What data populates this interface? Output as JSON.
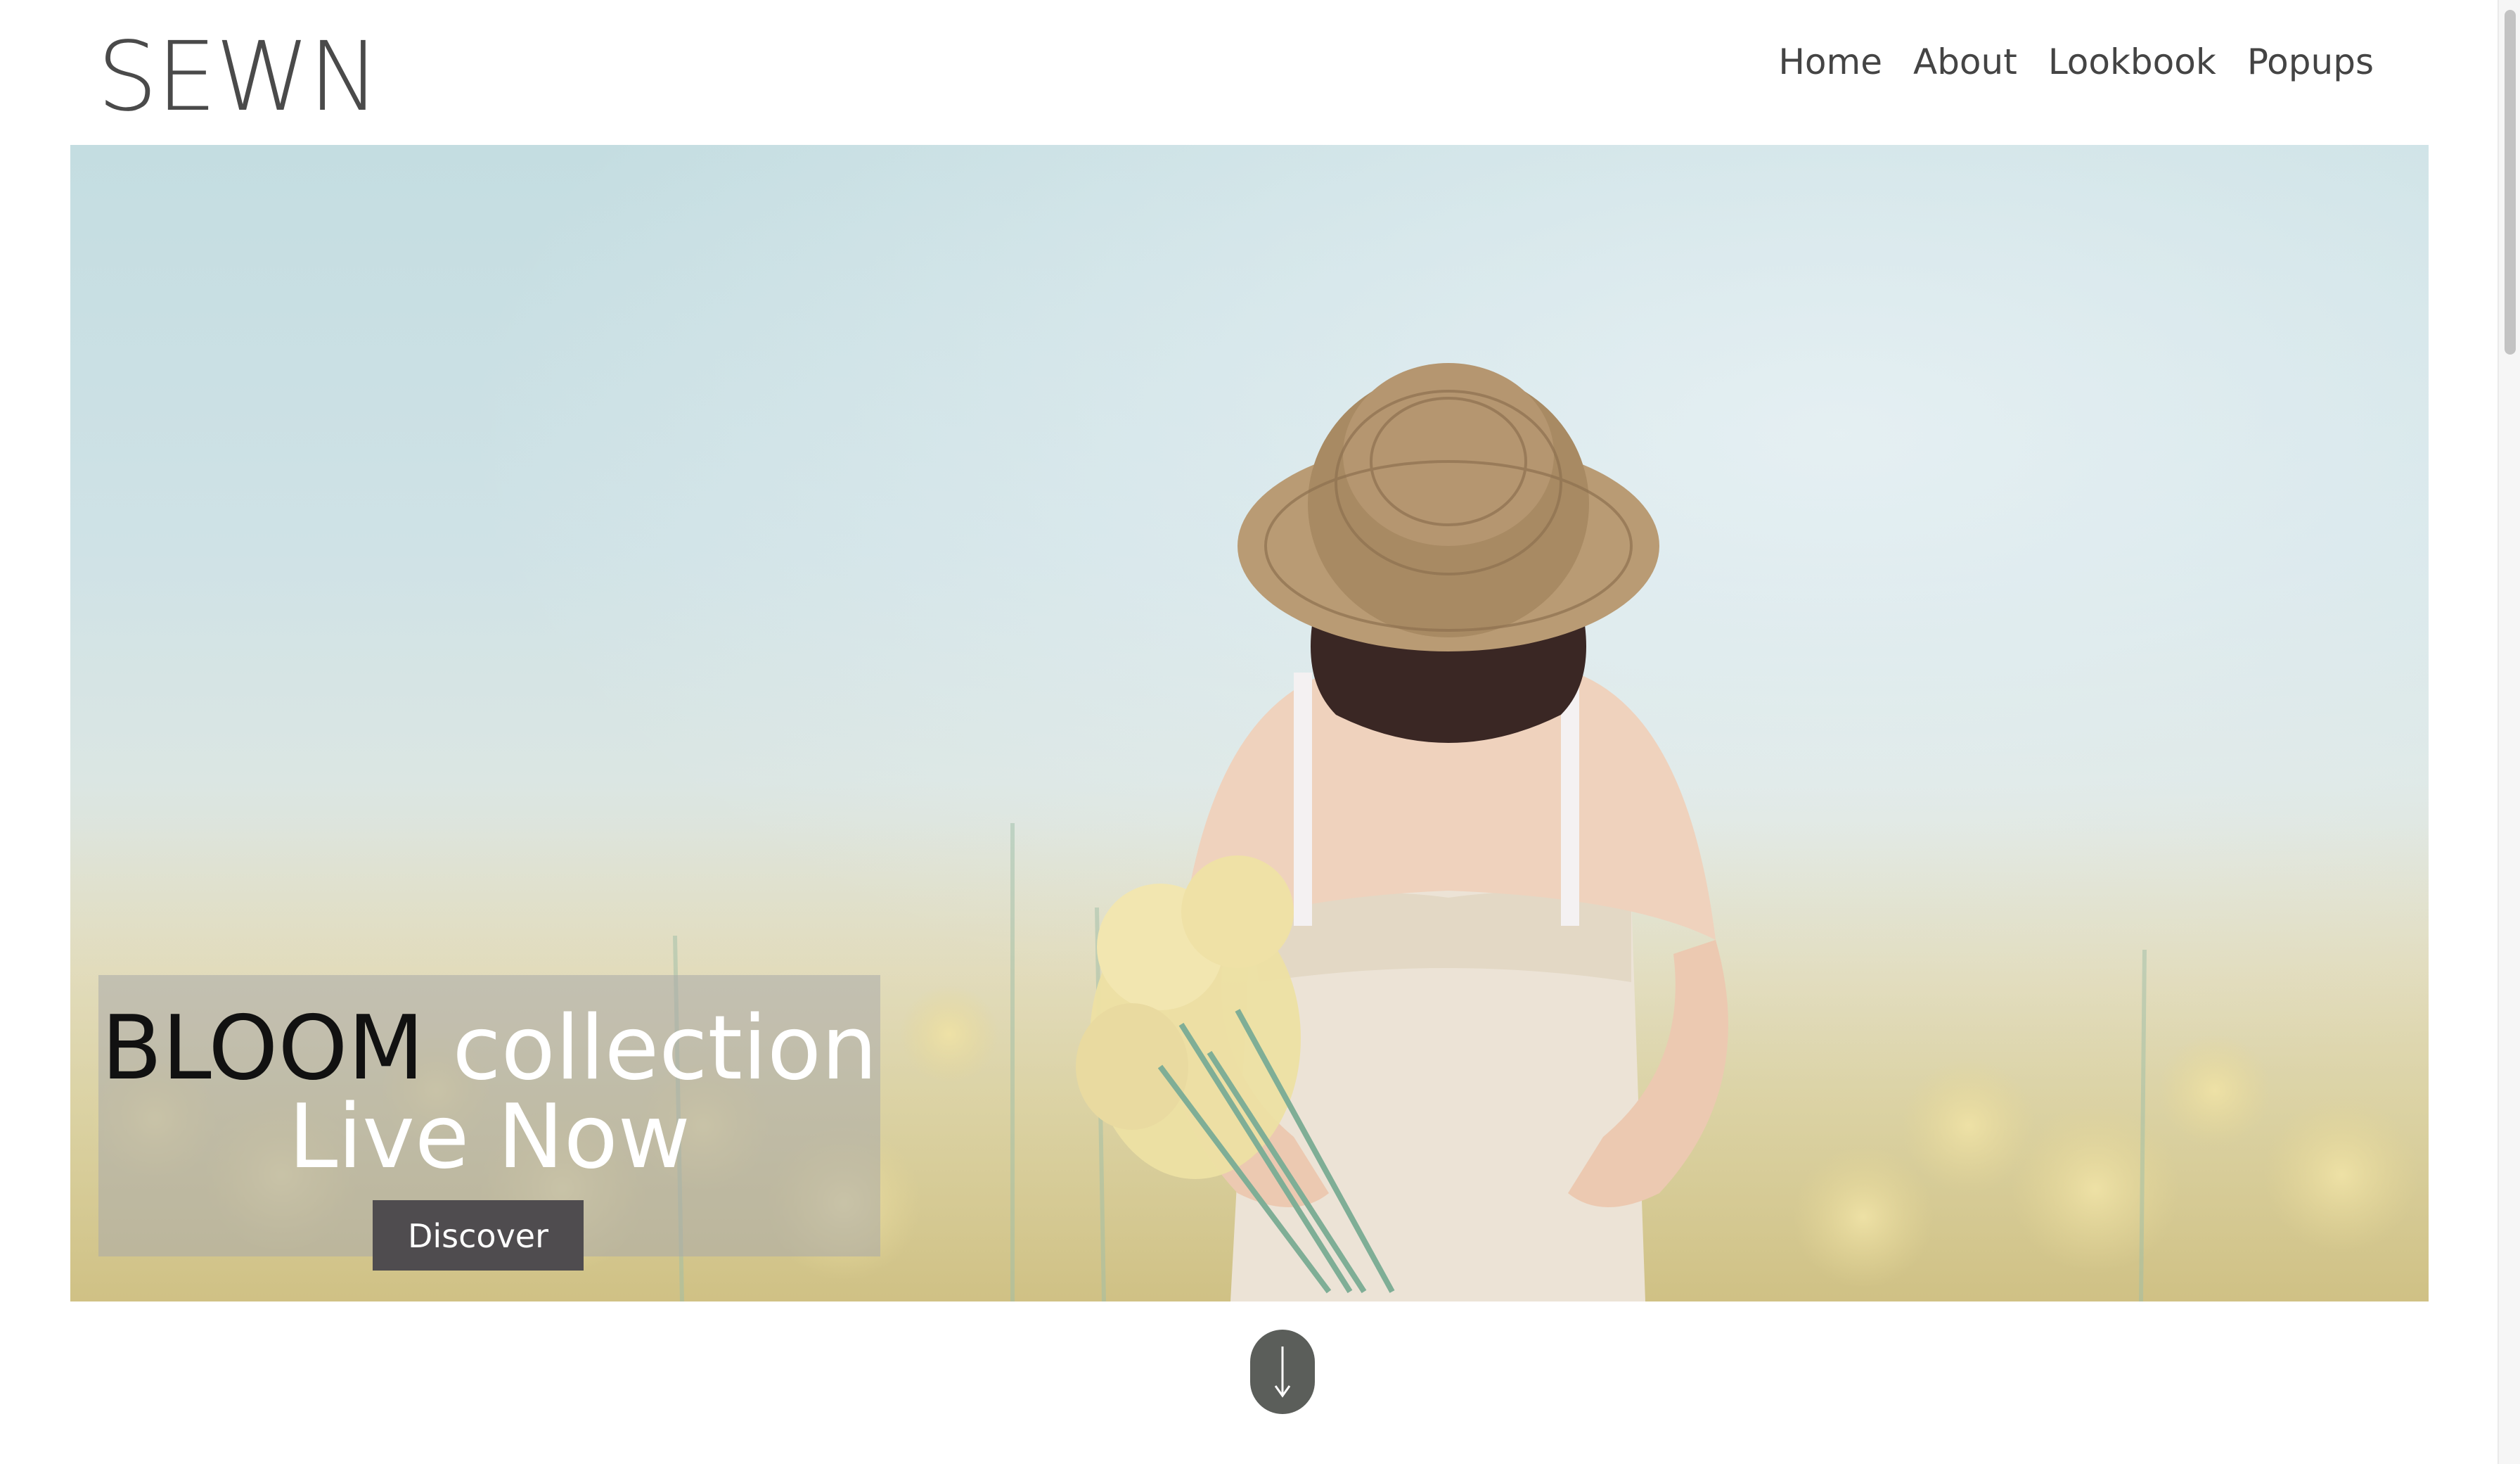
{
  "header": {
    "logo": "SEWN",
    "nav": [
      {
        "label": "Home"
      },
      {
        "label": "About"
      },
      {
        "label": "Lookbook"
      },
      {
        "label": "Popups"
      }
    ]
  },
  "hero": {
    "headline_strong": "BLOOM",
    "headline_soft": "collection",
    "subline": "Live Now",
    "cta_label": "Discover"
  },
  "scroll_indicator": {
    "glyph": "↓"
  },
  "colors": {
    "logo": "#4a4a4a",
    "nav_text": "#444444",
    "cta_background": "#4f4c4f",
    "overlay": "rgba(170,170,170,0.55)",
    "scroll_pill": "#5b5e5a"
  },
  "icons": {
    "scroll": "arrow-down-icon"
  }
}
